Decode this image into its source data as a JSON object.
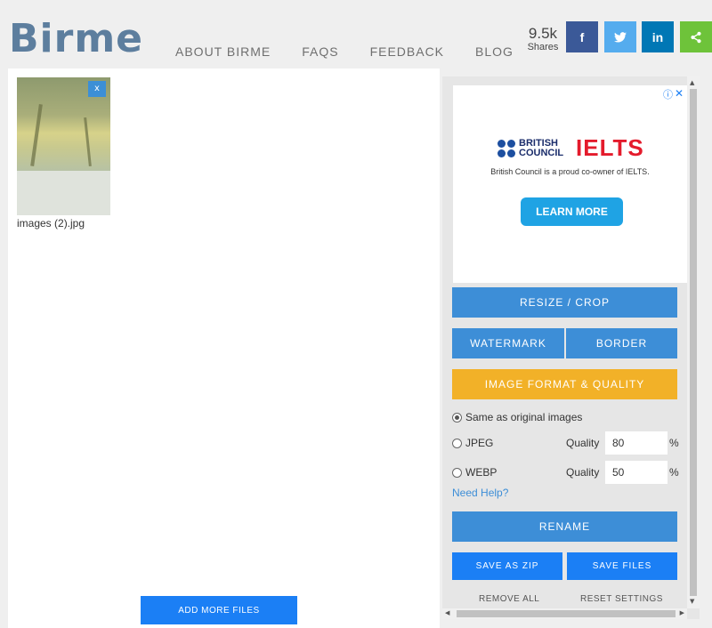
{
  "header": {
    "logo": "Birme",
    "nav": [
      "ABOUT BIRME",
      "FAQS",
      "FEEDBACK",
      "BLOG"
    ],
    "shares_count": "9.5k",
    "shares_label": "Shares",
    "social": [
      {
        "name": "facebook",
        "glyph": "f",
        "color": "#3b5998"
      },
      {
        "name": "twitter",
        "glyph": "🐦",
        "color": "#55acee"
      },
      {
        "name": "linkedin",
        "glyph": "in",
        "color": "#0077b5"
      },
      {
        "name": "share",
        "glyph": "<",
        "color": "#6ec33a"
      }
    ]
  },
  "files": {
    "items": [
      {
        "name": "images (2).jpg",
        "close": "x"
      }
    ],
    "add_more": "ADD MORE FILES"
  },
  "ad": {
    "brand": "BRITISH COUNCIL",
    "brand_line1": "BRITISH",
    "brand_line2": "COUNCIL",
    "product": "IELTS",
    "tagline": "British Council is a proud co-owner of IELTS.",
    "cta": "LEARN MORE",
    "info": "ⓘ",
    "close": "✕"
  },
  "panel": {
    "resize_crop": "RESIZE / CROP",
    "watermark": "WATERMARK",
    "border": "BORDER",
    "format_quality": "IMAGE FORMAT & QUALITY",
    "format_options": [
      {
        "label": "Same as original images",
        "selected": true
      },
      {
        "label": "JPEG",
        "selected": false,
        "quality_label": "Quality",
        "quality": "80",
        "unit": "%"
      },
      {
        "label": "WEBP",
        "selected": false,
        "quality_label": "Quality",
        "quality": "50",
        "unit": "%"
      }
    ],
    "need_help": "Need Help?",
    "rename": "RENAME",
    "save_zip": "SAVE AS ZIP",
    "save_files": "SAVE FILES",
    "remove_all": "REMOVE ALL",
    "reset_settings": "RESET SETTINGS"
  },
  "colors": {
    "accent_blue": "#3d8ed7",
    "bright_blue": "#1b7ff5",
    "orange": "#f2b128",
    "logo": "#5d7e9e"
  }
}
